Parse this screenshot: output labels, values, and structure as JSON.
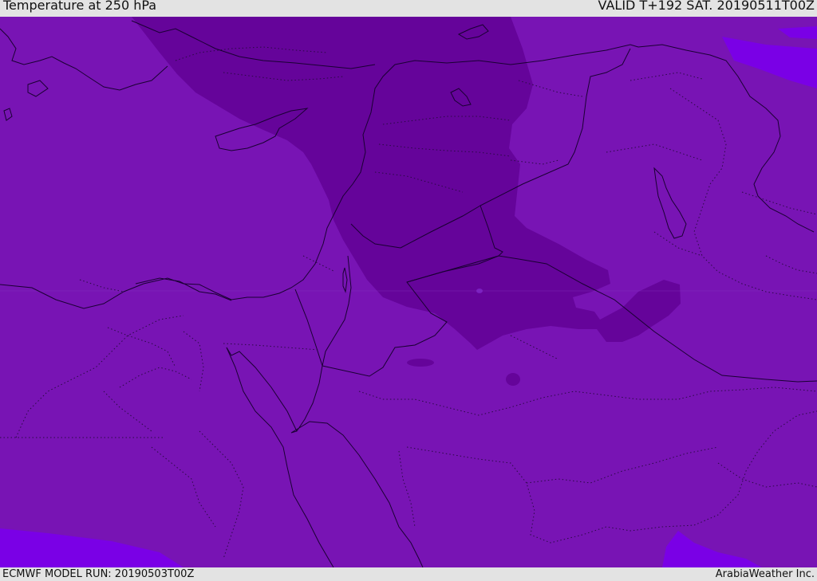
{
  "header": {
    "title": "Temperature at 250 hPa",
    "valid": "VALID T+192 SAT. 20190511T00Z"
  },
  "footer": {
    "model_run": "ECMWF MODEL RUN: 20190503T00Z",
    "credit": "ArabiaWeather Inc."
  },
  "map": {
    "field_colors": {
      "base": "#7814b4",
      "cold": "#65049a",
      "warm": "#7a00e6"
    },
    "line_colors": {
      "country_border": "#1a0033",
      "province_border": "#2a0a44"
    }
  }
}
